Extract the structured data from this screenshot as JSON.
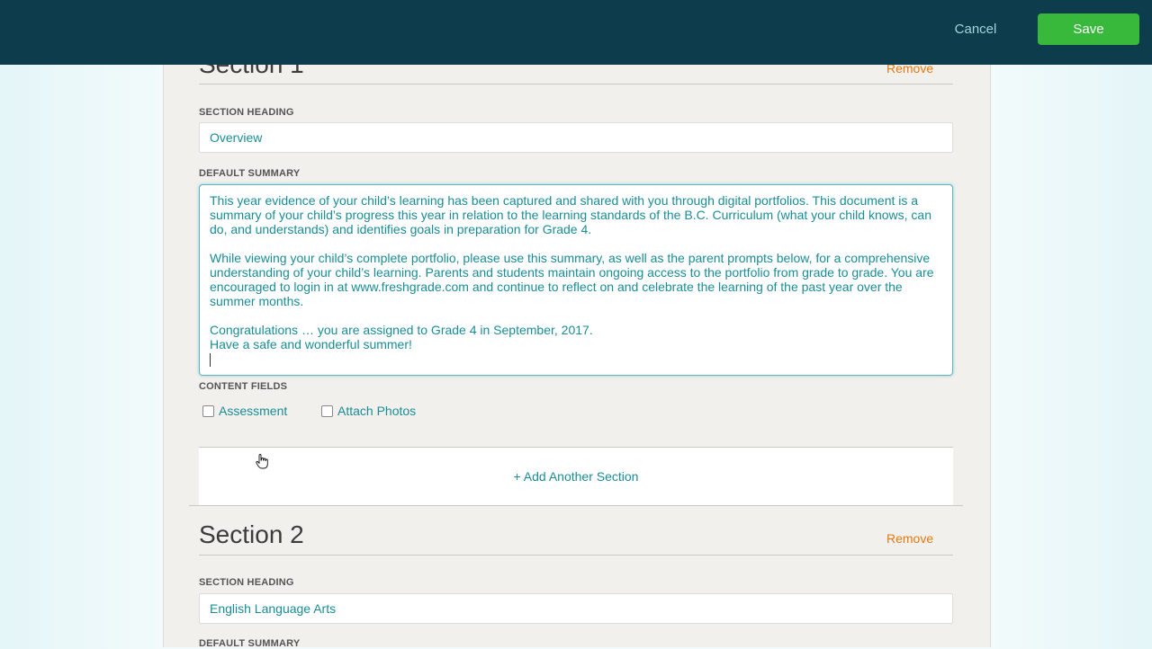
{
  "toolbar": {
    "cancel_label": "Cancel",
    "save_label": "Save"
  },
  "sections": [
    {
      "title": "Section 1",
      "remove_label": "Remove",
      "heading_label": "SECTION HEADING",
      "heading_value": "Overview",
      "summary_label": "DEFAULT SUMMARY",
      "summary_paragraphs": [
        "This year evidence of your child’s learning has been captured and shared with you through digital portfolios. This document is a summary of your child’s progress this year in relation to the learning standards of the B.C. Curriculum (what your child knows, can do, and understands) and identifies goals in preparation for Grade 4.",
        "While viewing your child’s complete portfolio, please use this summary, as well as the parent prompts below,  for a comprehensive understanding of your child’s learning. Parents and students maintain ongoing access to the portfolio from grade to grade. You are encouraged to login in at www.freshgrade.com and continue to reflect on and celebrate the learning of the past year over the summer months.",
        "Congratulations … you are assigned to Grade 4 in September, 2017."
      ],
      "summary_last_line": "Have a safe and wonderful summer!",
      "content_fields_label": "CONTENT FIELDS",
      "content_fields": [
        "Assessment",
        "Attach Photos"
      ]
    },
    {
      "title": "Section 2",
      "remove_label": "Remove",
      "heading_label": "SECTION HEADING",
      "heading_value": "English Language Arts",
      "summary_label": "DEFAULT SUMMARY"
    }
  ],
  "add_section_label": "+ Add Another Section",
  "colors": {
    "topbar": "#0d3c4c",
    "save": "#39b93b",
    "accent_text": "#1a8c96",
    "remove": "#e07a10"
  }
}
